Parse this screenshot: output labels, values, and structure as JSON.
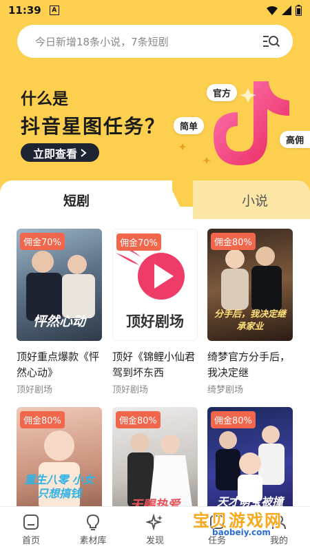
{
  "status": {
    "time": "11:39",
    "notif": "A"
  },
  "search": {
    "placeholder": "今日新增18条小说，7条短剧",
    "icon": "search-list-icon"
  },
  "banner": {
    "question": "什么是",
    "headline": "抖音星图任务？",
    "button": "立即查看",
    "tags": [
      "官方",
      "简单",
      "高佣"
    ]
  },
  "tabs": {
    "active": "短剧",
    "inactive": "小说"
  },
  "cards": [
    {
      "badge": "佣金70%",
      "poster_text": "怦然心动",
      "title": "顶好重点爆款《怦然心动》",
      "source": "顶好剧场"
    },
    {
      "badge": "佣金70%",
      "poster_text": "顶好剧场",
      "title": "顶好《锦鲤小仙君驾到坏东西",
      "source": "顶好剧场"
    },
    {
      "badge": "佣金80%",
      "poster_text": "分手后，我决定继承家业",
      "title": "绮梦官方分手后，我决定继",
      "source": "绮梦剧场"
    },
    {
      "badge": "佣金80%",
      "poster_text": "重生八零 小女只想搞钱",
      "title": "",
      "source": ""
    },
    {
      "badge": "佣金80%",
      "poster_text": "天赐热爱",
      "title": "",
      "source": ""
    },
    {
      "badge": "佣金80%",
      "poster_text": "天才萌宝被撞",
      "title": "",
      "source": ""
    }
  ],
  "nav": [
    {
      "label": "首页",
      "icon": "home-icon"
    },
    {
      "label": "素材库",
      "icon": "bulb-icon"
    },
    {
      "label": "发现",
      "icon": "sparkle-icon"
    },
    {
      "label": "任务",
      "icon": "task-icon"
    },
    {
      "label": "我的",
      "icon": "profile-icon"
    }
  ],
  "watermark": {
    "text": "宝贝游戏网",
    "url": "baobeiy.com"
  },
  "colors": {
    "brand_yellow": "#FDCF4E",
    "badge_red": "#F2664C",
    "tab_inactive": "#FCE7A6"
  }
}
